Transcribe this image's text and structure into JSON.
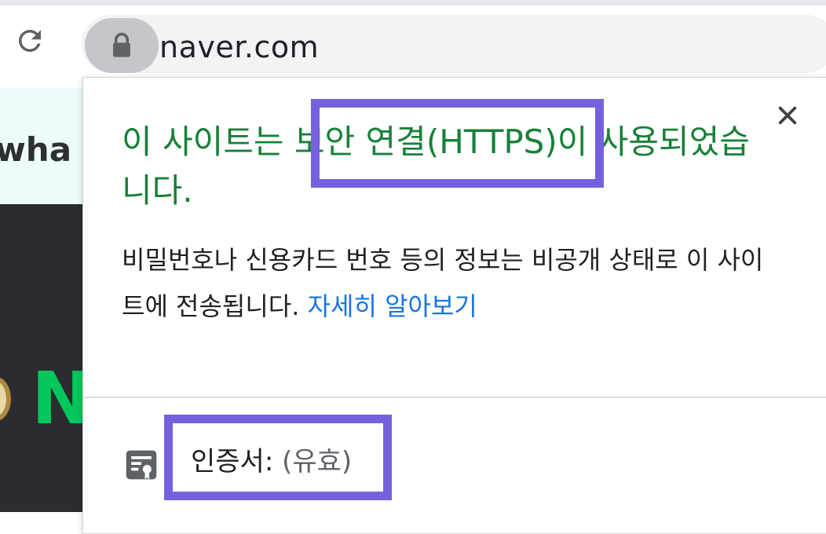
{
  "browser": {
    "url": "naver.com",
    "reload_icon": "reload-icon",
    "lock_icon": "lock-icon"
  },
  "page_behind": {
    "banner_text": "wha",
    "logo_letter": "N"
  },
  "popup": {
    "headline_pre": "이 사이트는 ",
    "headline_highlight": "보안 연결(HTTPS)",
    "headline_post": "이 사용되었습니다.",
    "description": "비밀번호나 신용카드 번호 등의 정보는 비공개 상태로 이 사이트에 전송됩니다. ",
    "learn_more": "자세히 알아보기",
    "close_icon": "close-icon",
    "certificate_icon": "certificate-icon",
    "certificate_label": "인증서: ",
    "certificate_status": "(유효)"
  },
  "colors": {
    "secure_green": "#188038",
    "link_blue": "#1a73e8",
    "highlight_purple": "#7560e0"
  }
}
